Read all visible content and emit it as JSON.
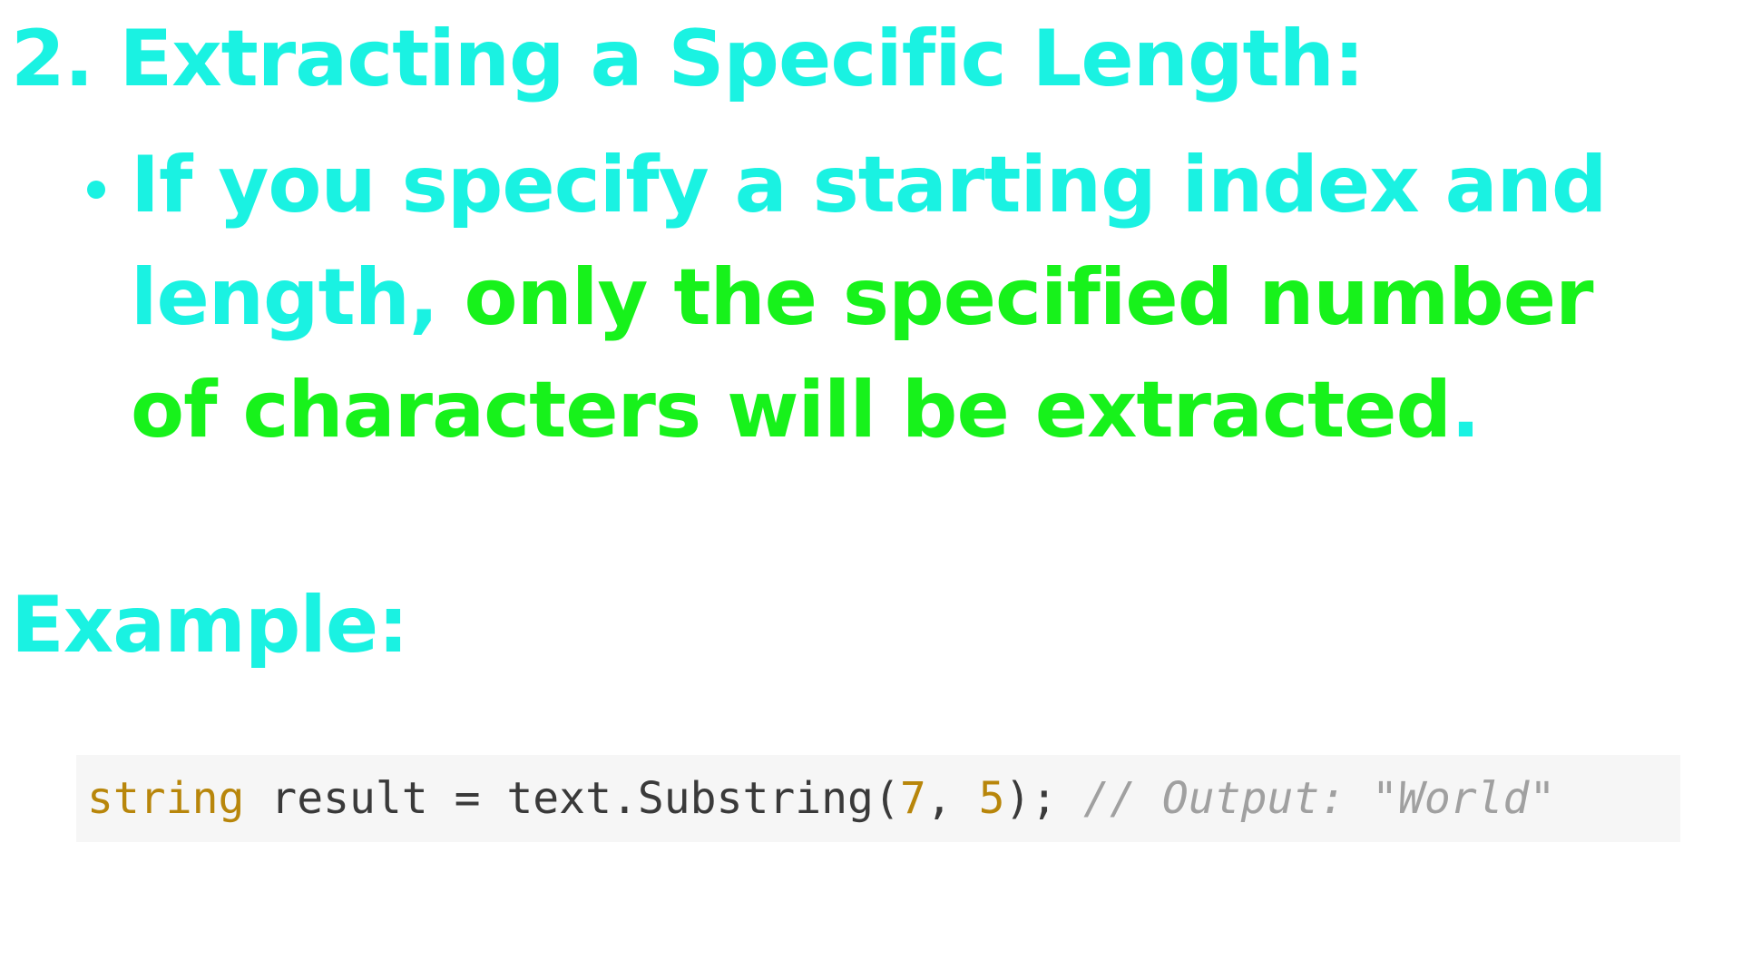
{
  "heading": "2. Extracting a Specific Length:",
  "bullet": {
    "part1": "If you specify a starting index and length, ",
    "highlight": "only the specified number of characters will be extracted",
    "part2": "."
  },
  "example_label": "Example:",
  "code": {
    "keyword": "string",
    "text1": " result = text.Substring(",
    "num1": "7",
    "text2": ", ",
    "num2": "5",
    "text3": "); ",
    "comment": "// Output: \"World\""
  },
  "colors": {
    "cyan": "#1af2e2",
    "green": "#17f21b",
    "code_background": "#f6f6f6"
  }
}
